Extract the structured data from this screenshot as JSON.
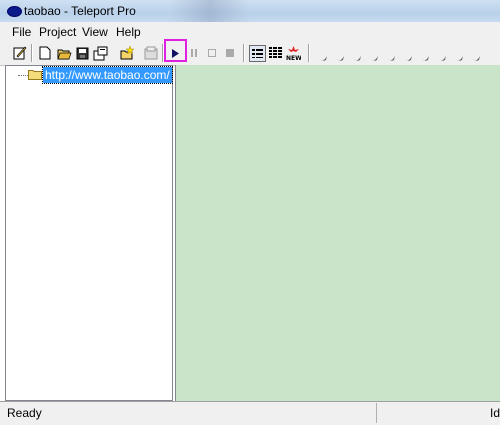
{
  "window": {
    "title": "taobao - Teleport Pro"
  },
  "menu": {
    "items": [
      "File",
      "Project",
      "View",
      "Help"
    ]
  },
  "tree": {
    "root_label": "http://www.taobao.com/"
  },
  "status": {
    "text": "Ready",
    "right_text": "Id"
  },
  "colors": {
    "highlight": "#e020e0",
    "pane_bg": "#c9e4c9",
    "selection": "#3399ff"
  },
  "icons": [
    "project-properties-icon",
    "new-project-icon",
    "open-project-icon",
    "save-project-icon",
    "project-wizard-icon",
    "add-address-icon",
    "disabled-icon",
    "start-icon",
    "pause-icon",
    "stop-soft-icon",
    "stop-icon",
    "details-view-icon",
    "grid-view-icon",
    "new-badge-icon"
  ]
}
